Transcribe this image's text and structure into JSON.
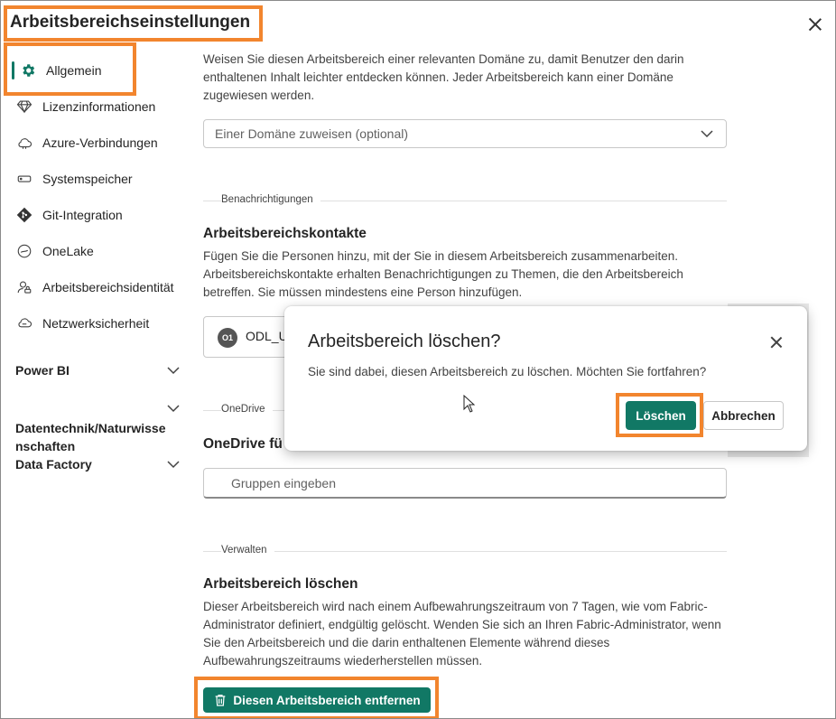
{
  "page": {
    "title": "Arbeitsbereichseinstellungen"
  },
  "sidebar": {
    "items": [
      {
        "label": "Allgemein",
        "icon": "gear-icon",
        "active": true
      },
      {
        "label": "Lizenzinformationen",
        "icon": "diamond-icon"
      },
      {
        "label": "Azure-Verbindungen",
        "icon": "cloud-icon"
      },
      {
        "label": "Systemspeicher",
        "icon": "storage-icon"
      },
      {
        "label": "Git-Integration",
        "icon": "git-icon"
      },
      {
        "label": "OneLake",
        "icon": "onelake-icon"
      },
      {
        "label": "Arbeitsbereichsidentität",
        "icon": "identity-icon"
      },
      {
        "label": "Netzwerksicherheit",
        "icon": "network-cloud-icon"
      }
    ],
    "sections": [
      {
        "label": "Power BI"
      },
      {
        "label": "Datentechnik/Naturwisse\nnschaften"
      },
      {
        "label": "Data Factory"
      }
    ]
  },
  "main": {
    "domain_text": "Weisen Sie diesen Arbeitsbereich einer relevanten Domäne zu, damit Benutzer den darin enthaltenen Inhalt leichter entdecken können. Jeder Arbeitsbereich kann einer Domäne zugewiesen werden.",
    "domain_select_value": "Einer Domäne zuweisen (optional)",
    "notifications_label": "Benachrichtigungen",
    "contacts_heading": "Arbeitsbereichskontakte",
    "contacts_text": "Fügen Sie die Personen hinzu, mit der Sie in diesem Arbeitsbereich zusammenarbeiten. Arbeitsbereichskontakte erhalten Benachrichtigungen zu Themen, die den Arbeitsbereich betreffen. Sie müssen mindestens eine Person hinzufügen.",
    "contact_initials": "O1",
    "contact_name": "ODL_U",
    "onedrive_label": "OneDrive",
    "onedrive_heading": "OneDrive fü",
    "groups_placeholder": "Gruppen eingeben",
    "manage_label": "Verwalten",
    "delete_heading": "Arbeitsbereich löschen",
    "delete_text": "Dieser Arbeitsbereich wird nach einem Aufbewahrungszeitraum von 7 Tagen, wie vom Fabric-Administrator definiert, endgültig gelöscht. Wenden Sie sich an Ihren Fabric-Administrator, wenn Sie den Arbeitsbereich und die darin enthaltenen Elemente während dieses Aufbewahrungszeitraums wiederherstellen müssen.",
    "remove_button": "Diesen Arbeitsbereich entfernen"
  },
  "dialog": {
    "title": "Arbeitsbereich löschen?",
    "message": "Sie sind dabei, diesen Arbeitsbereich zu löschen. Möchten Sie fortfahren?",
    "confirm_label": "Löschen",
    "cancel_label": "Abbrechen"
  },
  "colors": {
    "accent": "#117865",
    "highlight": "#f2852e"
  }
}
